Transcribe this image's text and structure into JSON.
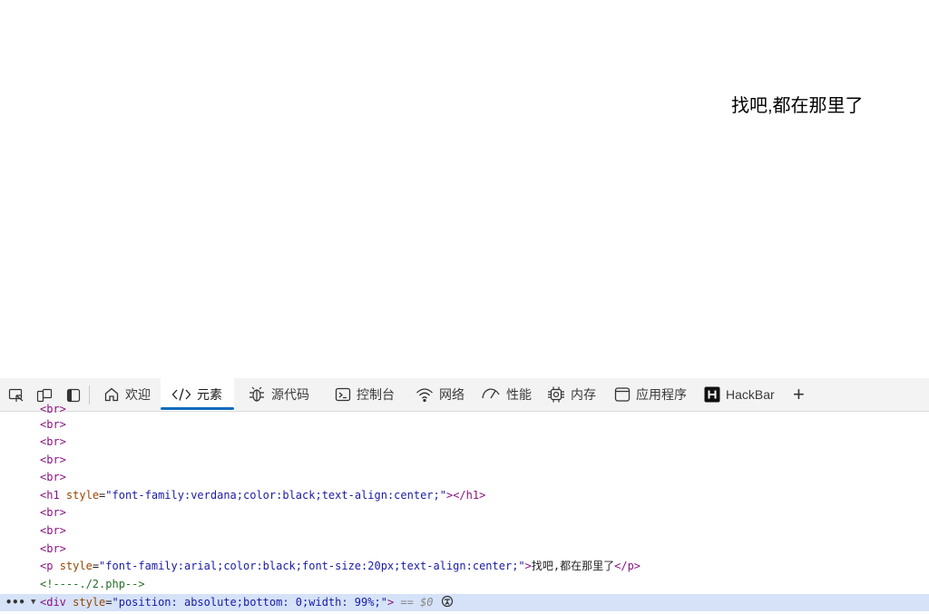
{
  "page": {
    "text": "找吧,都在那里了"
  },
  "devtools": {
    "tabs": [
      {
        "label": "欢迎",
        "icon": "home-icon"
      },
      {
        "label": "元素",
        "icon": "code-icon",
        "active": true
      },
      {
        "label": "源代码",
        "icon": "bug-icon"
      },
      {
        "label": "控制台",
        "icon": "console-icon"
      },
      {
        "label": "网络",
        "icon": "wifi-icon"
      },
      {
        "label": "性能",
        "icon": "performance-icon"
      },
      {
        "label": "内存",
        "icon": "memory-chip-icon"
      },
      {
        "label": "应用程序",
        "icon": "application-icon"
      },
      {
        "label": "HackBar",
        "icon": "hackbar-logo-icon"
      }
    ],
    "add_tab_label": "+"
  },
  "elements": {
    "br": "<br>",
    "h1": {
      "open": "<h1",
      "attr": "style",
      "eq": "=",
      "value": "\"font-family:verdana;color:black;text-align:center;\"",
      "close": "></h1>"
    },
    "p": {
      "open": "<p",
      "attr": "style",
      "eq": "=",
      "value": "\"font-family:arial;color:black;font-size:20px;text-align:center;\"",
      "gt": ">",
      "text": "找吧,都在那里了",
      "close": "</p>"
    },
    "comment": "<!----./2.php-->",
    "div": {
      "ellipsis": "•••",
      "open": "<div",
      "attr": "style",
      "eq": "=",
      "value": "\"position: absolute;bottom: 0;width: 99%;\"",
      "gt": ">",
      "selected_marker": "== $0"
    }
  }
}
